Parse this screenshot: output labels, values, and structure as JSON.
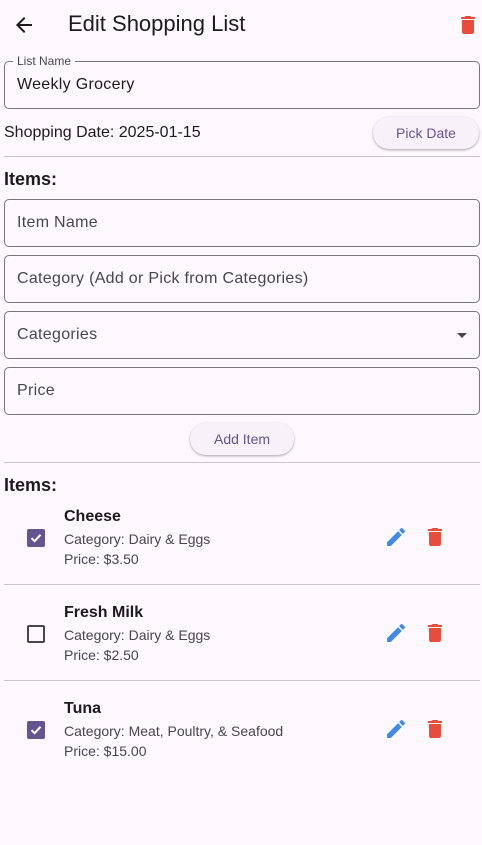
{
  "app_bar": {
    "title": "Edit Shopping List",
    "back_icon": "arrow-back-icon",
    "delete_icon": "trash-icon",
    "delete_color": "#e74c3c"
  },
  "list_name_field": {
    "label": "List Name",
    "value": "Weekly Grocery"
  },
  "shopping_date": {
    "text": "Shopping Date: 2025-01-15",
    "pick_button_label": "Pick Date"
  },
  "add_item_form": {
    "section_title": "Items:",
    "item_name_placeholder": "Item Name",
    "category_placeholder": "Category (Add or Pick from Categories)",
    "categories_dropdown_label": "Categories",
    "price_placeholder": "Price",
    "add_button_label": "Add Item"
  },
  "items_list": {
    "section_title": "Items:",
    "items": [
      {
        "name": "Cheese",
        "category": "Category: Dairy & Eggs",
        "price": "Price: $3.50",
        "checked": true
      },
      {
        "name": "Fresh Milk",
        "category": "Category: Dairy & Eggs",
        "price": "Price: $2.50",
        "checked": false
      },
      {
        "name": "Tuna",
        "category": "Category: Meat, Poultry, & Seafood",
        "price": "Price: $15.00",
        "checked": true
      }
    ]
  },
  "colors": {
    "background": "#fdf7fe",
    "primary": "#65558f",
    "edit_icon": "#3f8be6",
    "delete_icon": "#e74c3c",
    "outline": "#7a757f"
  }
}
